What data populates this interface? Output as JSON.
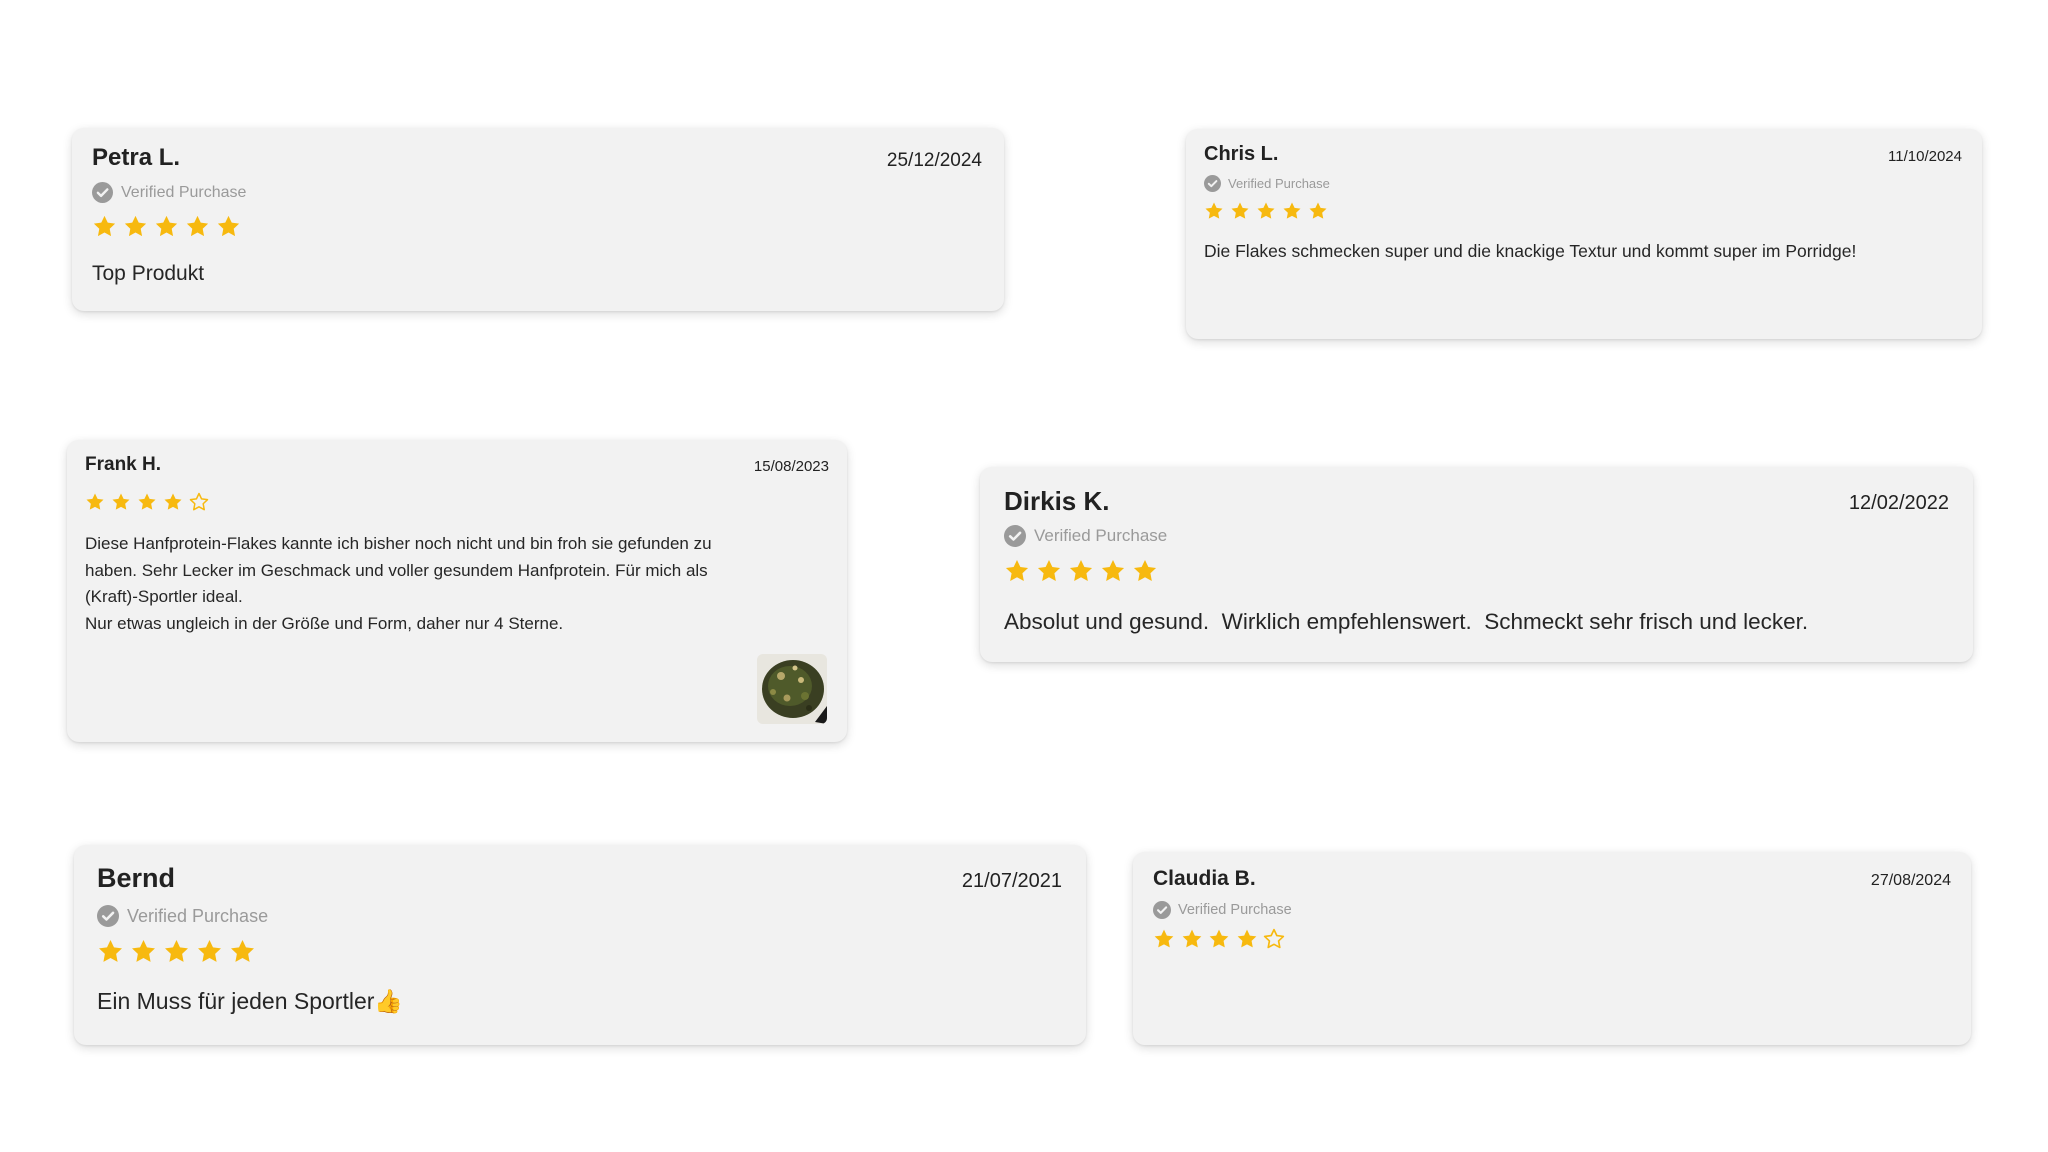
{
  "colors": {
    "background": "#ffffff",
    "card_background": "#f2f2f2",
    "star_filled": "#f7b90f",
    "verified_gray": "#9a9a9a"
  },
  "reviews": [
    {
      "name": "Petra L.",
      "date": "25/12/2024",
      "verified": "Verified Purchase",
      "rating": 5,
      "text": "Top Produkt"
    },
    {
      "name": "Chris L.",
      "date": "11/10/2024",
      "verified": "Verified Purchase",
      "rating": 5,
      "text": "Die Flakes schmecken super und die knackige Textur und kommt super im Porridge!"
    },
    {
      "name": "Frank H.",
      "date": "15/08/2023",
      "rating": 4,
      "text_lines": [
        "Diese Hanfprotein-Flakes kannte ich bisher noch nicht und bin froh sie gefunden zu",
        "haben. Sehr Lecker im Geschmack und voller gesundem Hanfprotein. Für mich als",
        "(Kraft)-Sportler ideal.",
        "Nur etwas ungleich in der Größe und Form, daher nur 4 Sterne."
      ],
      "photo_icon": "product-photo-thumbnail"
    },
    {
      "name": "Dirkis K.",
      "date": "12/02/2022",
      "verified": "Verified Purchase",
      "rating": 5,
      "text": "Absolut und gesund.  Wirklich empfehlenswert.  Schmeckt sehr frisch und lecker."
    },
    {
      "name": "Bernd",
      "date": "21/07/2021",
      "verified": "Verified Purchase",
      "rating": 5,
      "text": "Ein Muss für jeden Sportler👍"
    },
    {
      "name": "Claudia B.",
      "date": "27/08/2024",
      "verified": "Verified Purchase",
      "rating": 4,
      "text": ""
    }
  ]
}
